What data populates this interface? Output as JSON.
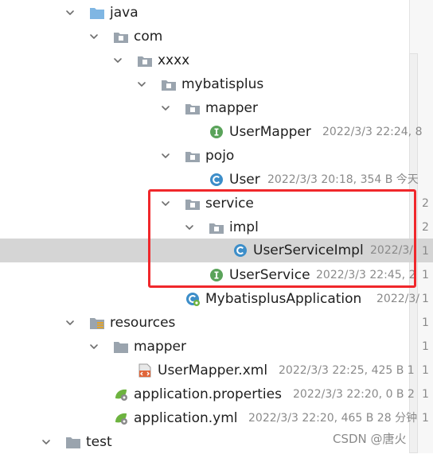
{
  "tree": {
    "java": {
      "label": "java"
    },
    "com": {
      "label": "com"
    },
    "xxxx": {
      "label": "xxxx"
    },
    "mybatisplus": {
      "label": "mybatisplus"
    },
    "mapper_pkg": {
      "label": "mapper"
    },
    "user_mapper": {
      "label": "UserMapper",
      "meta": "2022/3/3 22:24, 8"
    },
    "pojo": {
      "label": "pojo"
    },
    "user": {
      "label": "User",
      "meta": "2022/3/3 20:18, 354 B 今天"
    },
    "service": {
      "label": "service"
    },
    "impl": {
      "label": "impl"
    },
    "user_service_impl": {
      "label": "UserServiceImpl",
      "meta": "2022/3/"
    },
    "user_service": {
      "label": "UserService",
      "meta": "2022/3/3 22:45, 2"
    },
    "app": {
      "label": "MybatisplusApplication",
      "meta": "2022/3/"
    },
    "resources": {
      "label": "resources"
    },
    "mapper_res": {
      "label": "mapper"
    },
    "user_mapper_xml": {
      "label": "UserMapper.xml",
      "meta": "2022/3/3 22:25, 425 B 1"
    },
    "app_properties": {
      "label": "application.properties",
      "meta": "2022/3/3 22:20, 0 B 2"
    },
    "app_yml": {
      "label": "application.yml",
      "meta": "2022/3/3 22:20, 465 B 28 分钟"
    },
    "test": {
      "label": "test"
    }
  },
  "right_strip": [
    "2",
    "2",
    "2",
    "2",
    "2",
    "2",
    "2",
    "1",
    "1",
    "1",
    "1",
    "1",
    "1",
    "1",
    "1",
    "1"
  ],
  "watermark": "CSDN @唐火",
  "colors": {
    "selection": "#d5d5d5",
    "highlight_border": "#f0272b",
    "folder_blue": "#7fb6e3",
    "folder_gray": "#9aa4ae",
    "interface_green": "#5aa35a",
    "class_blue": "#3d8ec9"
  },
  "icons": {
    "folder_source": "source-folder-icon",
    "package": "package-icon",
    "interface": "interface-icon",
    "class": "class-icon",
    "spring_boot_class": "spring-boot-class-icon",
    "resources_folder": "resources-folder-icon",
    "folder": "folder-icon",
    "xml_file": "xml-file-icon",
    "spring_config": "spring-config-icon",
    "chevron_down": "chevron-down-icon"
  }
}
